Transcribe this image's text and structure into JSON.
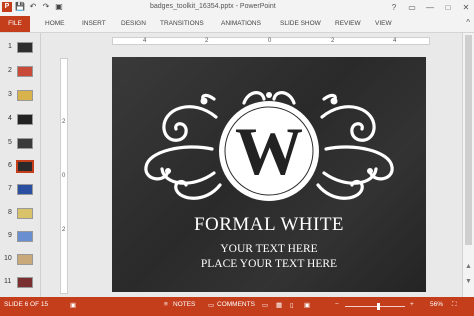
{
  "window": {
    "title": "badges_toolkit_16354.pptx - PowerPoint"
  },
  "qat": {
    "app_icon": "P",
    "save_icon": "💾",
    "undo_icon": "↶",
    "redo_icon": "↷",
    "present_icon": "▣"
  },
  "window_controls": {
    "help": "?",
    "restore": "▭",
    "minimize": "—",
    "maximize": "□",
    "close": "✕"
  },
  "ribbon": {
    "tabs": [
      "FILE",
      "HOME",
      "INSERT",
      "DESIGN",
      "TRANSITIONS",
      "ANIMATIONS",
      "SLIDE SHOW",
      "REVIEW",
      "VIEW"
    ],
    "collapse": "^"
  },
  "thumbnails": [
    {
      "num": "1",
      "color": "#2e2e2e",
      "selected": false
    },
    {
      "num": "2",
      "color": "#c84b3a",
      "selected": false
    },
    {
      "num": "3",
      "color": "#d8b24a",
      "selected": false
    },
    {
      "num": "4",
      "color": "#222222",
      "selected": false
    },
    {
      "num": "5",
      "color": "#3a3a3a",
      "selected": false
    },
    {
      "num": "6",
      "color": "#2a2a2a",
      "selected": true
    },
    {
      "num": "7",
      "color": "#2b4fa0",
      "selected": false
    },
    {
      "num": "8",
      "color": "#d9c36a",
      "selected": false
    },
    {
      "num": "9",
      "color": "#6a8fd0",
      "selected": false
    },
    {
      "num": "10",
      "color": "#c9a97a",
      "selected": false
    },
    {
      "num": "11",
      "color": "#7a3030",
      "selected": false
    }
  ],
  "ruler": {
    "h_labels": [
      "4",
      "2",
      "0",
      "2",
      "4"
    ],
    "v_labels": [
      "2",
      "0",
      "2"
    ]
  },
  "slide": {
    "monogram": "W",
    "title": "FORMAL WHITE",
    "line1": "YOUR TEXT HERE",
    "line2": "PLACE YOUR TEXT HERE"
  },
  "statusbar": {
    "slide_info": "SLIDE 6 OF 15",
    "notes": "NOTES",
    "comments": "COMMENTS",
    "zoom": "56%",
    "zoom_level": 0.56
  }
}
